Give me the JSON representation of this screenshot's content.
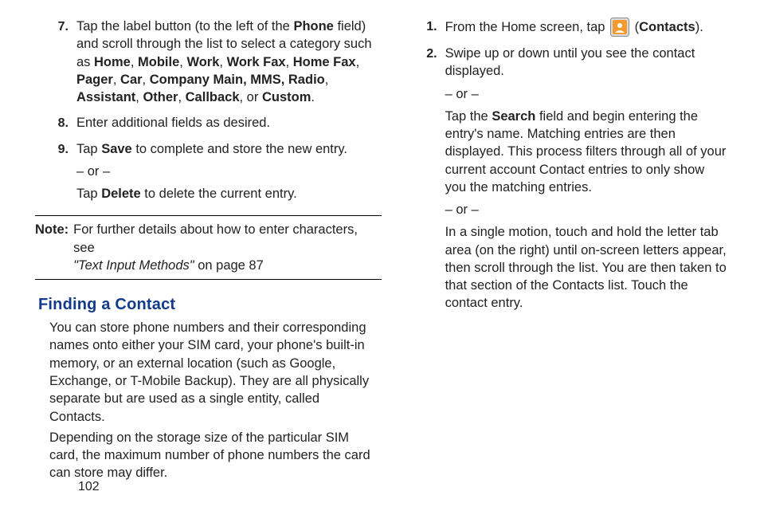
{
  "left": {
    "steps": {
      "s7": {
        "num": "7.",
        "pre": "Tap the label button (to the left of the ",
        "phone": "Phone",
        "post_phone": " field) and scroll through the list to select a category such as ",
        "c1": "Home",
        "sep1": ", ",
        "c2": "Mobile",
        "sep2": ", ",
        "c3": "Work",
        "sep3": ", ",
        "c4": "Work Fax",
        "sep4": ", ",
        "c5": "Home Fax",
        "sep5": ", ",
        "c6": "Pager",
        "sep6": ", ",
        "c7": "Car",
        "sep7": ", ",
        "c8": "Company Main, MMS, Radio",
        "sep8": ", ",
        "c9": "Assistant",
        "sep9": ", ",
        "c10": "Other",
        "sep10": ", ",
        "c11": "Callback",
        "sep11": ", or ",
        "c12": "Custom",
        "sep12": "."
      },
      "s8": {
        "num": "8.",
        "text": "Enter additional fields as desired."
      },
      "s9": {
        "num": "9.",
        "pre": "Tap ",
        "save": "Save",
        "post_save": " to complete and store the new entry.",
        "or": "– or –",
        "pre2": "Tap ",
        "delete": "Delete",
        "post_delete": " to delete the current entry."
      }
    },
    "note": {
      "label": "Note:",
      "line1": "For further details about how to enter characters, see",
      "ital": "\"Text Input Methods\"",
      "line2": " on page 87"
    },
    "heading": "Finding a Contact",
    "para1": "You can store phone numbers and their corresponding names onto either your SIM card, your phone's built-in memory, or an external location (such as Google, Exchange, or T-Mobile Backup). They are all physically separate but are used as a single entity, called Contacts.",
    "para2": "Depending on the storage size of the particular SIM card, the maximum number of phone numbers the card can store may differ."
  },
  "right": {
    "s1": {
      "num": "1.",
      "pre": "From the Home screen, tap ",
      "open_paren": "  (",
      "contacts": "Contacts",
      "close_paren": ")."
    },
    "s2": {
      "num": "2.",
      "line1": "Swipe up or down until you see the contact displayed.",
      "or1": "– or –",
      "pre2": "Tap the ",
      "search": "Search",
      "post2": " field and begin entering the entry's name. Matching entries are then displayed. This process filters through all of your current account Contact entries to only show you the matching entries.",
      "or2": "– or –",
      "line3": "In a single motion, touch and hold the letter tab area (on the right) until on-screen letters appear, then scroll through the list. You are then taken to that section of the Contacts list. Touch the contact entry."
    }
  },
  "pagenum": "102"
}
